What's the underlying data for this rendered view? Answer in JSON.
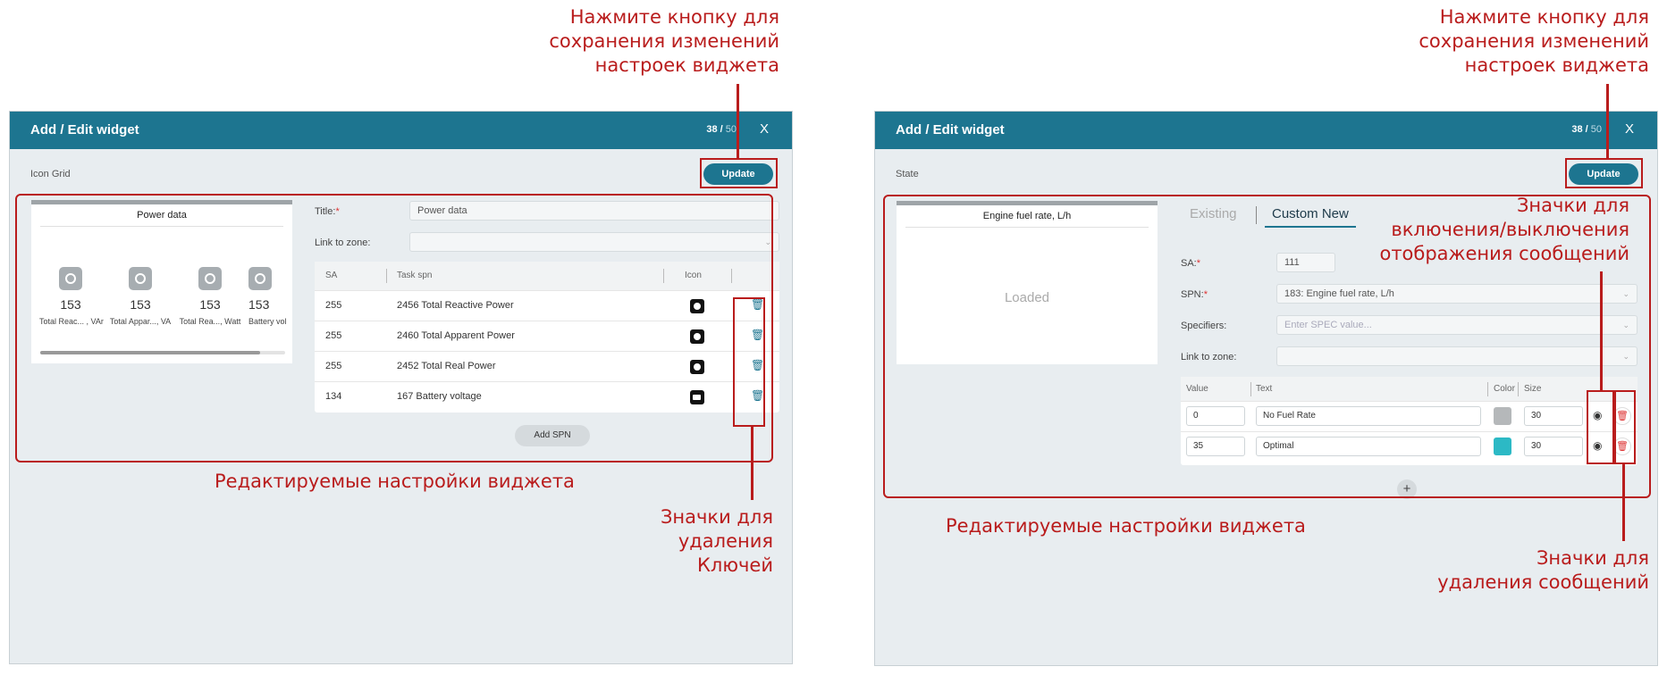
{
  "left": {
    "header_title": "Add / Edit widget",
    "counter_current": "38 /",
    "counter_total": "50",
    "close": "X",
    "widget_type": "Icon Grid",
    "update_label": "Update",
    "preview": {
      "title": "Power data",
      "gauges": [
        {
          "value": "153",
          "name": "Total Reac... , VAr"
        },
        {
          "value": "153",
          "name": "Total Appar..., VA"
        },
        {
          "value": "153",
          "name": "Total Rea..., Watt"
        },
        {
          "value": "153",
          "name": "Battery vol"
        }
      ]
    },
    "form": {
      "title_label": "Title:",
      "required": "*",
      "title_value": "Power data",
      "zone_label": "Link to zone:",
      "zone_value": ""
    },
    "table": {
      "headers": {
        "sa": "SA",
        "task": "Task spn",
        "icon": "Icon"
      },
      "rows": [
        {
          "sa": "255",
          "task": "2456 Total Reactive Power"
        },
        {
          "sa": "255",
          "task": "2460 Total Apparent Power"
        },
        {
          "sa": "255",
          "task": "2452 Total Real Power"
        },
        {
          "sa": "134",
          "task": "167 Battery voltage"
        }
      ]
    },
    "add_spn_label": "Add SPN",
    "annotations": {
      "save": [
        "Нажмите кнопку для",
        "сохранения изменений",
        "настроек виджета"
      ],
      "editable": "Редактируемые настройки виджета",
      "delete": [
        "Значки для",
        "удаления",
        "Ключей"
      ]
    }
  },
  "right": {
    "header_title": "Add / Edit widget",
    "counter_current": "38 /",
    "counter_total": "50",
    "close": "X",
    "widget_type": "State",
    "update_label": "Update",
    "preview": {
      "title": "Engine fuel rate, L/h",
      "status": "Loaded"
    },
    "tabs": {
      "existing": "Existing",
      "custom": "Custom New"
    },
    "form": {
      "sa_label": "SA:",
      "sa_value": "111",
      "spn_label": "SPN:",
      "spn_value": "183: Engine fuel rate, L/h",
      "spec_label": "Specifiers:",
      "spec_placeholder": "Enter SPEC value...",
      "zone_label": "Link to zone:",
      "required": "*"
    },
    "table": {
      "headers": {
        "value": "Value",
        "text": "Text",
        "color": "Color",
        "size": "Size"
      },
      "rows": [
        {
          "value": "0",
          "text": "No Fuel Rate",
          "color": "#b5b8ba",
          "size": "30"
        },
        {
          "value": "35",
          "text": "Optimal",
          "color": "#2cb9c5",
          "size": "30"
        }
      ]
    },
    "add_label": "+",
    "annotations": {
      "save": [
        "Нажмите кнопку для",
        "сохранения изменений",
        "настроек виджета"
      ],
      "toggle": [
        "Значки для",
        "включения/выключения",
        "отображения сообщений"
      ],
      "editable": "Редактируемые настройки виджета",
      "delete": [
        "Значки для",
        "удаления сообщений"
      ]
    }
  },
  "colors": {
    "header": "#1d7590",
    "annotation": "#b91c1c"
  }
}
